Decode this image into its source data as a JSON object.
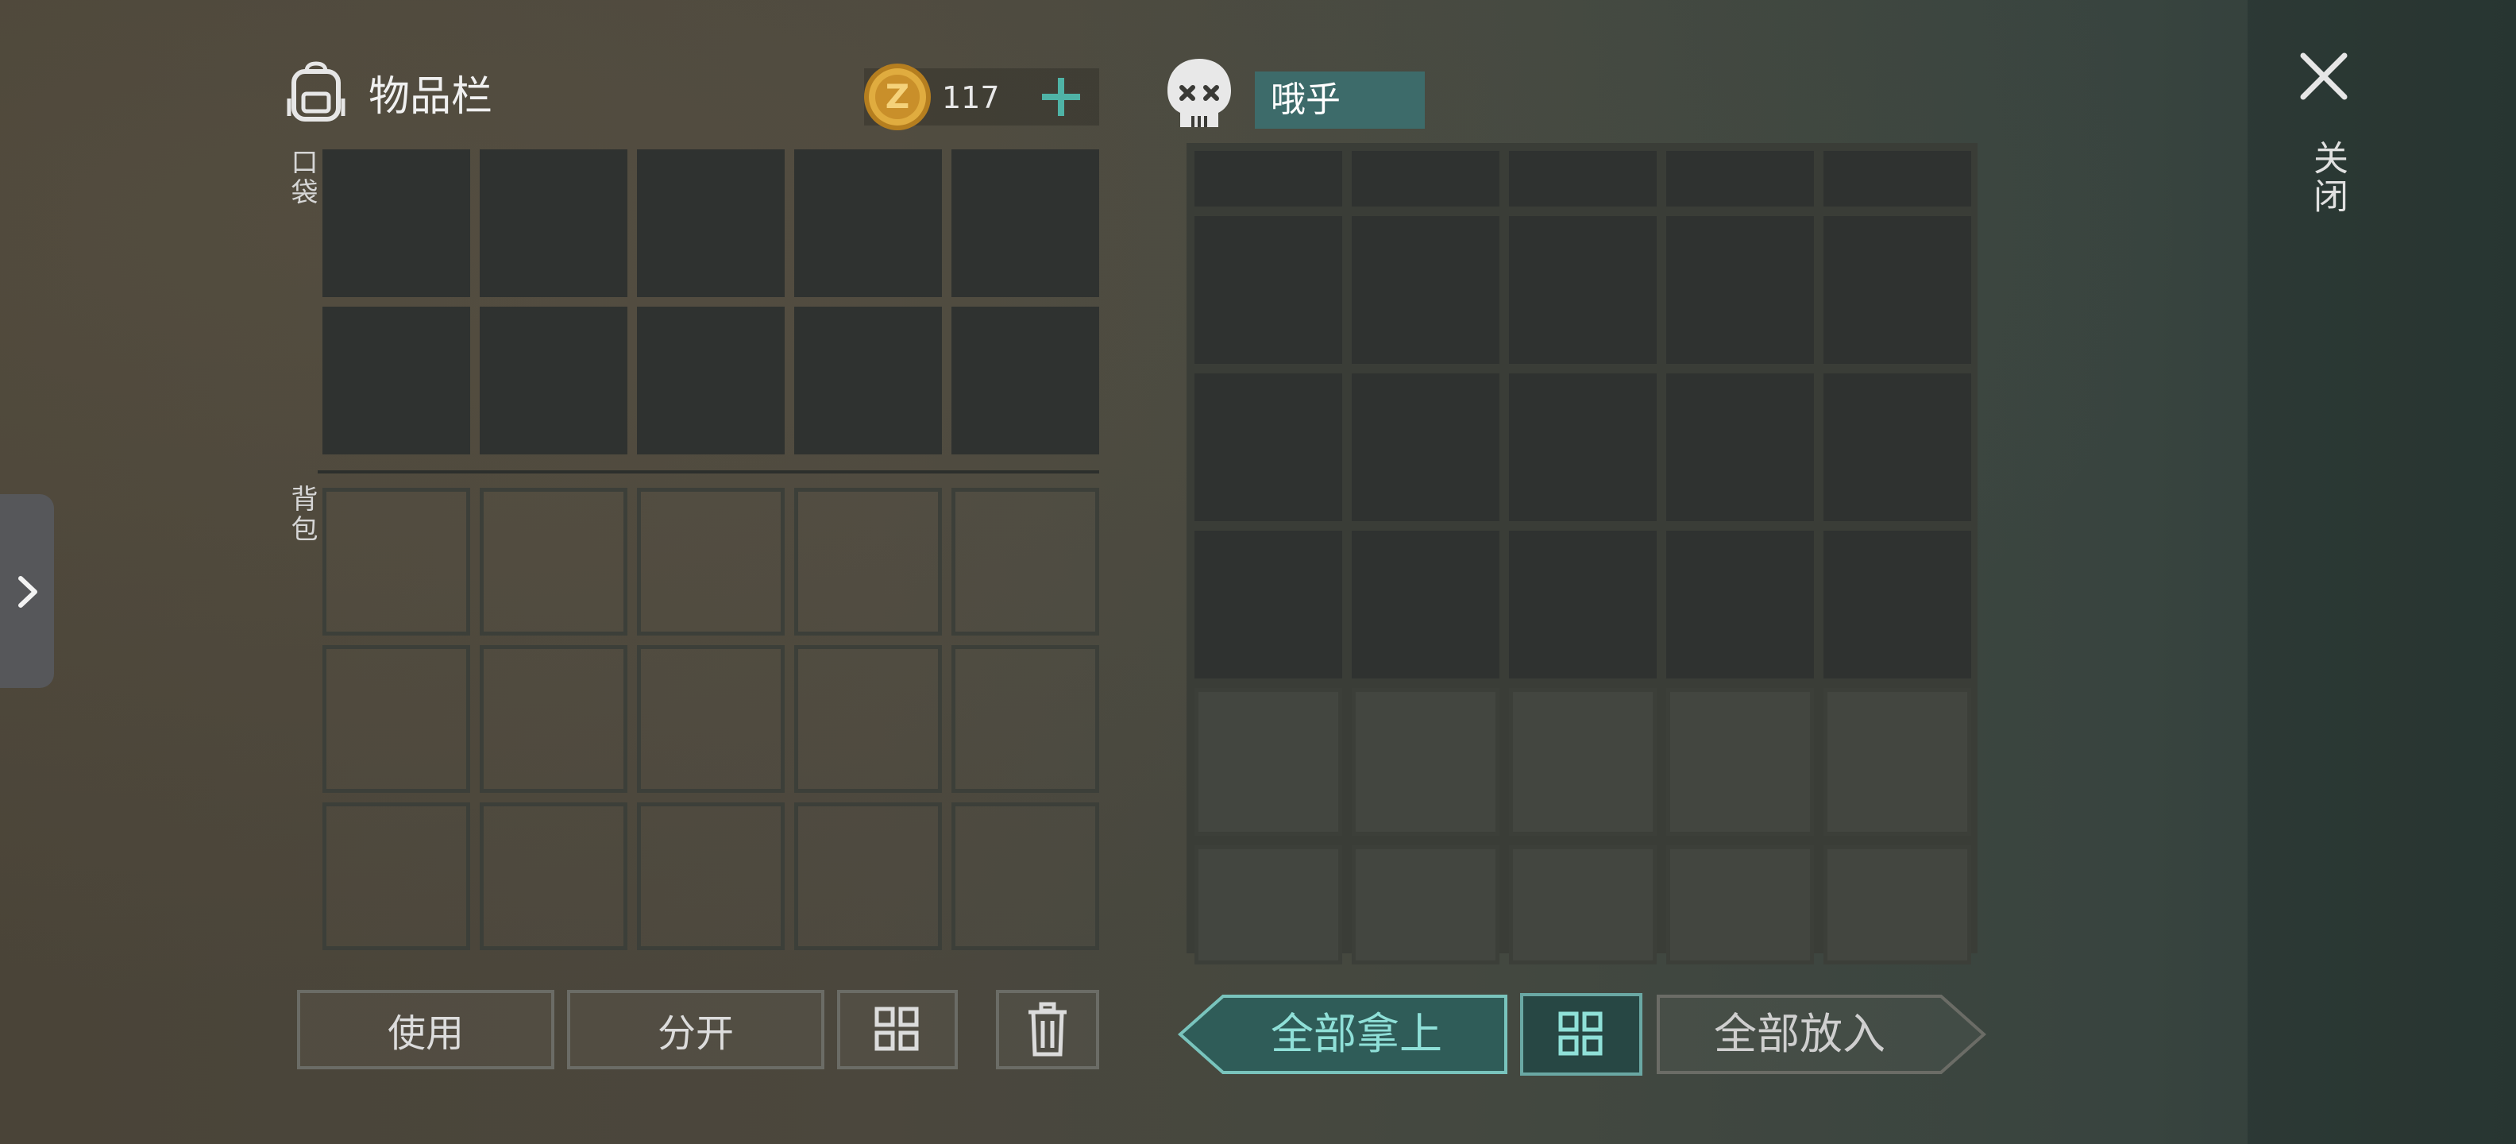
{
  "inventory": {
    "title": "物品栏",
    "coins": "117",
    "pocket_label": "口袋",
    "backpack_label": "背包"
  },
  "loot": {
    "name": "哦乎"
  },
  "close": {
    "label": "关闭"
  },
  "buttons": {
    "use": "使用",
    "split": "分开",
    "take_all": "全部拿上",
    "put_all": "全部放入"
  },
  "colors": {
    "accent": "#3d6b6a",
    "take_all_fill": "#2f5c58",
    "take_all_text": "#8fe0d8",
    "coin": "#d9a43a"
  },
  "icons": [
    "backpack-icon",
    "coin-icon",
    "plus-icon",
    "skull-icon",
    "close-icon",
    "chevron-right-icon",
    "sort-icon",
    "trash-icon"
  ]
}
